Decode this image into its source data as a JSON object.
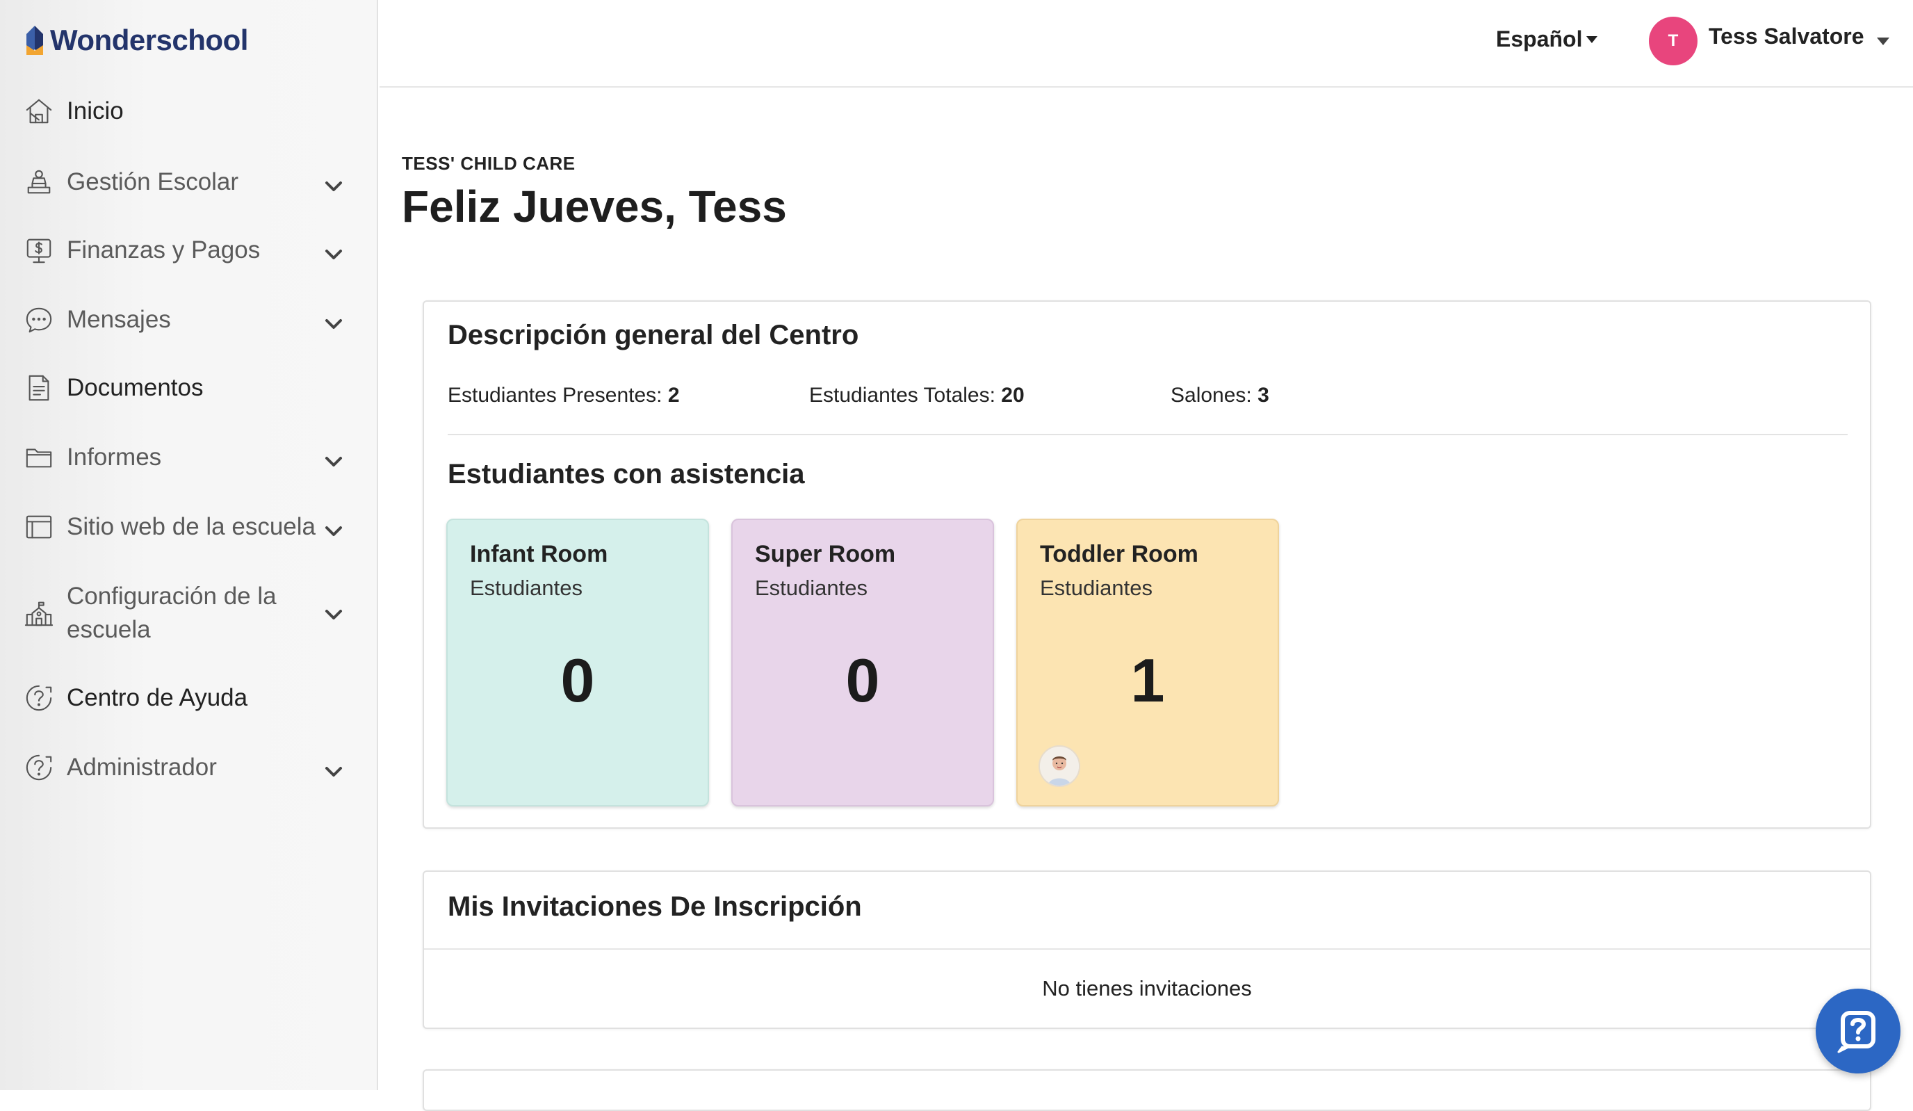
{
  "brand": {
    "name": "Wonderschool"
  },
  "sidebar": {
    "items": [
      {
        "label": "Inicio",
        "icon": "home-icon",
        "expandable": false,
        "active": true
      },
      {
        "label": "Gestión Escolar",
        "icon": "school-management-icon",
        "expandable": true
      },
      {
        "label": "Finanzas y Pagos",
        "icon": "billing-icon",
        "expandable": true
      },
      {
        "label": "Mensajes",
        "icon": "messages-icon",
        "expandable": true
      },
      {
        "label": "Documentos",
        "icon": "document-icon",
        "expandable": false,
        "active": true
      },
      {
        "label": "Informes",
        "icon": "folder-icon",
        "expandable": true
      },
      {
        "label": "Sitio web de la escuela",
        "icon": "website-icon",
        "expandable": true
      },
      {
        "label_line1": "Configuración de la",
        "label_line2": "escuela",
        "icon": "school-building-icon",
        "expandable": true
      },
      {
        "label": "Centro de Ayuda",
        "icon": "help-circle-icon",
        "expandable": false,
        "active": true
      },
      {
        "label": "Administrador",
        "icon": "admin-help-icon",
        "expandable": true
      }
    ]
  },
  "header": {
    "language": "Español",
    "user_initial": "T",
    "user_name": "Tess Salvatore",
    "avatar_color": "#e8457d"
  },
  "page": {
    "center_name": "TESS' CHILD CARE",
    "greeting": "Feliz Jueves, Tess"
  },
  "overview": {
    "title": "Descripción general del Centro",
    "present_label": "Estudiantes Presentes:",
    "present_value": "2",
    "total_label": "Estudiantes Totales:",
    "total_value": "20",
    "rooms_label": "Salones:",
    "rooms_value": "3"
  },
  "attendance": {
    "title": "Estudiantes con asistencia",
    "rooms": [
      {
        "name": "Infant Room",
        "sub": "Estudiantes",
        "count": "0",
        "color": "#d5f0eb"
      },
      {
        "name": "Super Room",
        "sub": "Estudiantes",
        "count": "0",
        "color": "#e8d5ea"
      },
      {
        "name": "Toddler Room",
        "sub": "Estudiantes",
        "count": "1",
        "color": "#fce4b2"
      }
    ]
  },
  "invitations": {
    "title": "Mis Invitaciones De Inscripción",
    "empty": "No tienes invitaciones"
  },
  "colors": {
    "accent_blue": "#2c67c4",
    "brand_navy": "#23346b"
  }
}
